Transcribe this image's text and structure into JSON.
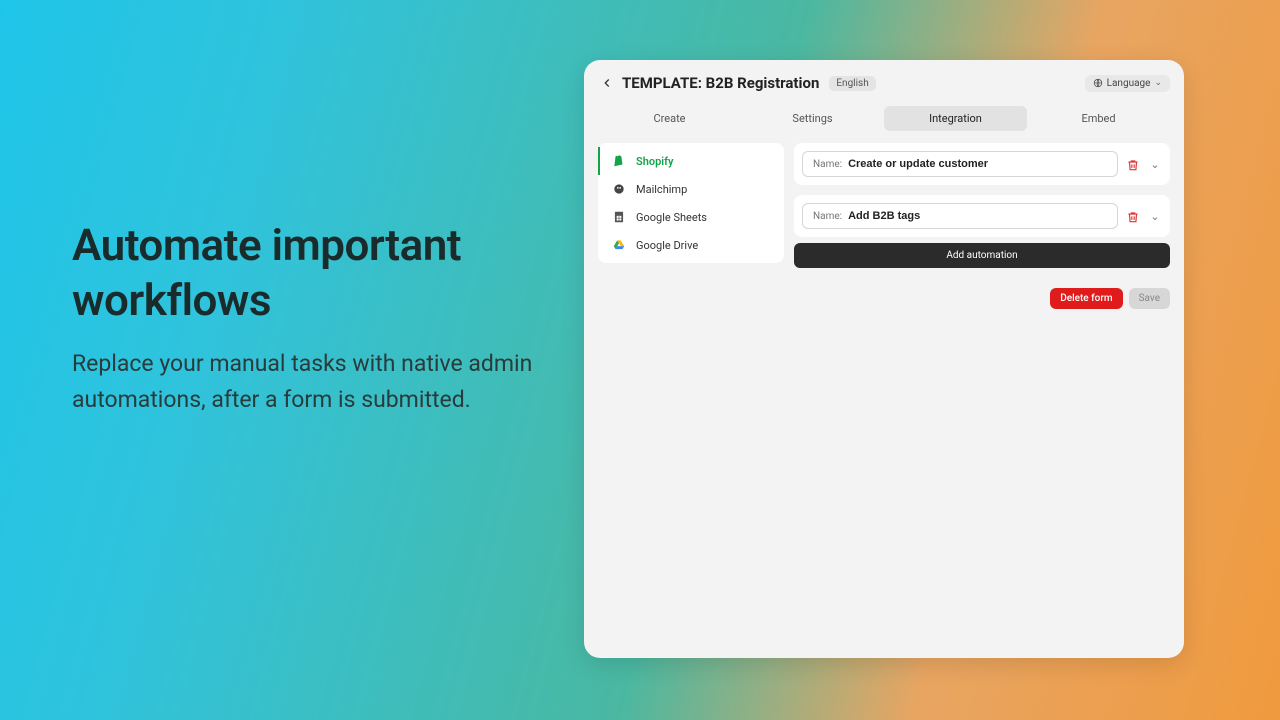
{
  "hero": {
    "title": "Automate important workflows",
    "subtitle": "Replace your manual tasks with native admin automations, after a form is submitted."
  },
  "header": {
    "title": "TEMPLATE: B2B Registration",
    "lang_badge": "English",
    "lang_button": "Language"
  },
  "tabs": {
    "items": [
      "Create",
      "Settings",
      "Integration",
      "Embed"
    ],
    "active_index": 2
  },
  "sidebar": {
    "items": [
      {
        "label": "Shopify",
        "icon": "shopify-icon",
        "active": true
      },
      {
        "label": "Mailchimp",
        "icon": "mailchimp-icon",
        "active": false
      },
      {
        "label": "Google Sheets",
        "icon": "sheets-icon",
        "active": false
      },
      {
        "label": "Google Drive",
        "icon": "drive-icon",
        "active": false
      }
    ]
  },
  "automations": [
    {
      "name_label": "Name:",
      "value": "Create or update customer"
    },
    {
      "name_label": "Name:",
      "value": "Add B2B tags"
    }
  ],
  "buttons": {
    "add_automation": "Add automation",
    "delete_form": "Delete form",
    "save": "Save"
  }
}
